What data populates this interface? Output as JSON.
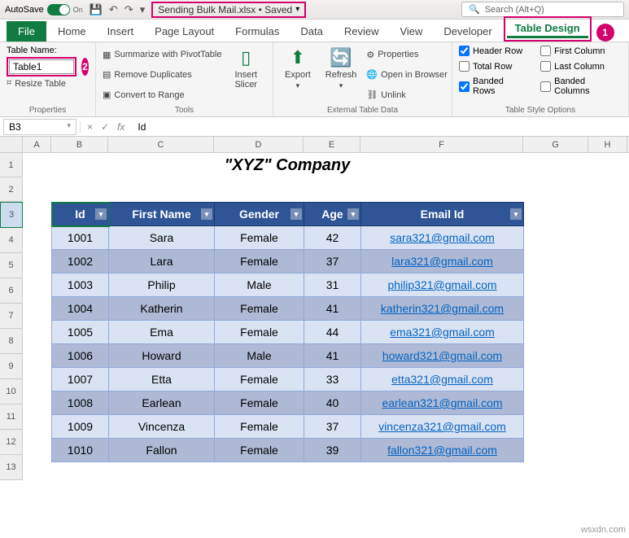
{
  "titlebar": {
    "autosave": "AutoSave",
    "toggle_state": "On",
    "filename": "Sending Bulk Mail.xlsx • Saved",
    "search_placeholder": "Search (Alt+Q)"
  },
  "tabs": [
    "File",
    "Home",
    "Insert",
    "Page Layout",
    "Formulas",
    "Data",
    "Review",
    "View",
    "Developer",
    "Table Design"
  ],
  "badges": {
    "tab": "1",
    "tablename": "2"
  },
  "ribbon": {
    "properties": {
      "label": "Properties",
      "tablename_label": "Table Name:",
      "tablename_value": "Table1",
      "resize": "Resize Table"
    },
    "tools": {
      "label": "Tools",
      "pivot": "Summarize with PivotTable",
      "dup": "Remove Duplicates",
      "range": "Convert to Range",
      "slicer": "Insert\nSlicer"
    },
    "external": {
      "label": "External Table Data",
      "export": "Export",
      "refresh": "Refresh",
      "props": "Properties",
      "browser": "Open in Browser",
      "unlink": "Unlink"
    },
    "styleopts": {
      "label": "Table Style Options",
      "header": "Header Row",
      "total": "Total Row",
      "banded_rows": "Banded Rows",
      "first_col": "First Column",
      "last_col": "Last Column",
      "banded_cols": "Banded Columns"
    }
  },
  "formula_bar": {
    "namebox": "B3",
    "value": "Id"
  },
  "columns": [
    "A",
    "B",
    "C",
    "D",
    "E",
    "F",
    "G",
    "H"
  ],
  "row_nums": [
    "1",
    "2",
    "3",
    "4",
    "5",
    "6",
    "7",
    "8",
    "9",
    "10",
    "11",
    "12",
    "13"
  ],
  "sheet_title": "\"XYZ\" Company",
  "table_headers": [
    "Id",
    "First Name",
    "Gender",
    "Age",
    "Email Id"
  ],
  "chart_data": {
    "type": "table",
    "rows": [
      {
        "id": "1001",
        "first": "Sara",
        "gender": "Female",
        "age": "42",
        "email": "sara321@gmail.com"
      },
      {
        "id": "1002",
        "first": "Lara",
        "gender": "Female",
        "age": "37",
        "email": "lara321@gmail.com"
      },
      {
        "id": "1003",
        "first": "Philip",
        "gender": "Male",
        "age": "31",
        "email": "philip321@gmail.com"
      },
      {
        "id": "1004",
        "first": "Katherin",
        "gender": "Female",
        "age": "41",
        "email": "katherin321@gmail.com"
      },
      {
        "id": "1005",
        "first": "Ema",
        "gender": "Female",
        "age": "44",
        "email": "ema321@gmail.com"
      },
      {
        "id": "1006",
        "first": "Howard",
        "gender": "Male",
        "age": "41",
        "email": "howard321@gmail.com"
      },
      {
        "id": "1007",
        "first": "Etta",
        "gender": "Female",
        "age": "33",
        "email": "etta321@gmail.com"
      },
      {
        "id": "1008",
        "first": "Earlean",
        "gender": "Female",
        "age": "40",
        "email": "earlean321@gmail.com"
      },
      {
        "id": "1009",
        "first": "Vincenza",
        "gender": "Female",
        "age": "37",
        "email": "vincenza321@gmail.com"
      },
      {
        "id": "1010",
        "first": "Fallon",
        "gender": "Female",
        "age": "39",
        "email": "fallon321@gmail.com"
      }
    ]
  },
  "watermark": "wsxdn.com"
}
